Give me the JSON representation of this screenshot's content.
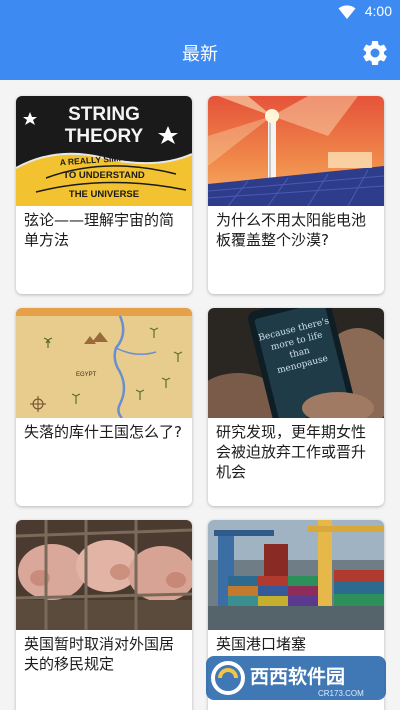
{
  "status": {
    "time": "4:00"
  },
  "header": {
    "title": "最新",
    "settings_icon": "gear-icon"
  },
  "colors": {
    "primary": "#3d8bf2",
    "card_bg": "#ffffff",
    "page_bg": "#f4f4f4"
  },
  "articles": [
    {
      "title": "弦论——理解宇宙的简单方法",
      "thumb_lines": [
        "STRING",
        "THEORY",
        "A REALLY SIMPLE WAY",
        "TO UNDERSTAND",
        "THE UNIVERSE"
      ]
    },
    {
      "title": "为什么不用太阳能电池板覆盖整个沙漠?"
    },
    {
      "title": "失落的库什王国怎么了?",
      "thumb_text": "EGYPT"
    },
    {
      "title": "研究发现，更年期女性会被迫放弃工作或晋升机会",
      "thumb_lines": [
        "Because there's",
        "more to life",
        "than",
        "menopause"
      ]
    },
    {
      "title": "英国暂时取消对外国居夫的移民规定"
    },
    {
      "title": "英国港口堵塞"
    }
  ],
  "watermark": {
    "main": "西西软件园",
    "sub": "CR173.COM"
  }
}
